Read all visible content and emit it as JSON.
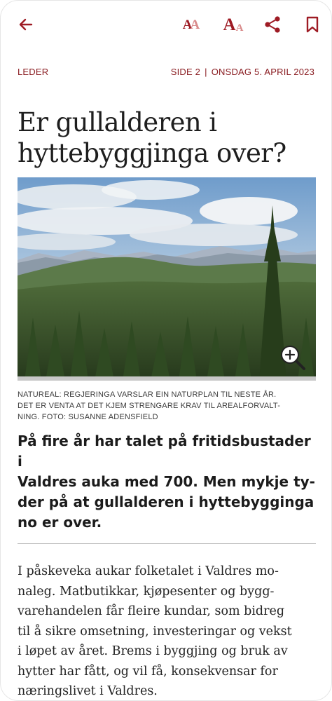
{
  "toolbar": {
    "back_icon": "arrow-left-icon",
    "font_smaller_label": "AA",
    "font_larger_label": "AA",
    "share_icon": "share-icon",
    "bookmark_icon": "bookmark-icon"
  },
  "article": {
    "section": "LEDER",
    "page": "SIDE 2",
    "separator": "|",
    "date": "ONSDAG 5. APRIL 2023",
    "headline": "Er gullalderen i hyttebyggjinga over?",
    "image_caption": "NATUREAL: REGJERINGA VARSLAR EIN NATURPLAN TIL NESTE ÅR.\nDET ER VENTA AT DET KJEM STRENGARE KRAV TIL AREALFORVALT-\nNING. FOTO: SUSANNE ADENSFIELD",
    "lead": "På fire år har talet på fritidsbustader i\nValdres auka med 700. Men mykje ty-\nder på at gullalderen i hyttebygginga\nno er over.",
    "body": "I påskeveka aukar folketalet i Valdres mo-\nnaleg. Matbutikkar, kjøpesenter og bygg-\nvarehandelen får fleire kundar, som bidreg\ntil å sikre omsetning, investeringar og vekst\ni løpet av året. Brems i byggjing og bruk av\nhytter har fått, og vil få, konsekvensar for\nnæringslivet i Valdres."
  },
  "colors": {
    "accent": "#9e1b24",
    "accent_light": "#d98c8c",
    "meta_text": "#8a1d22"
  }
}
